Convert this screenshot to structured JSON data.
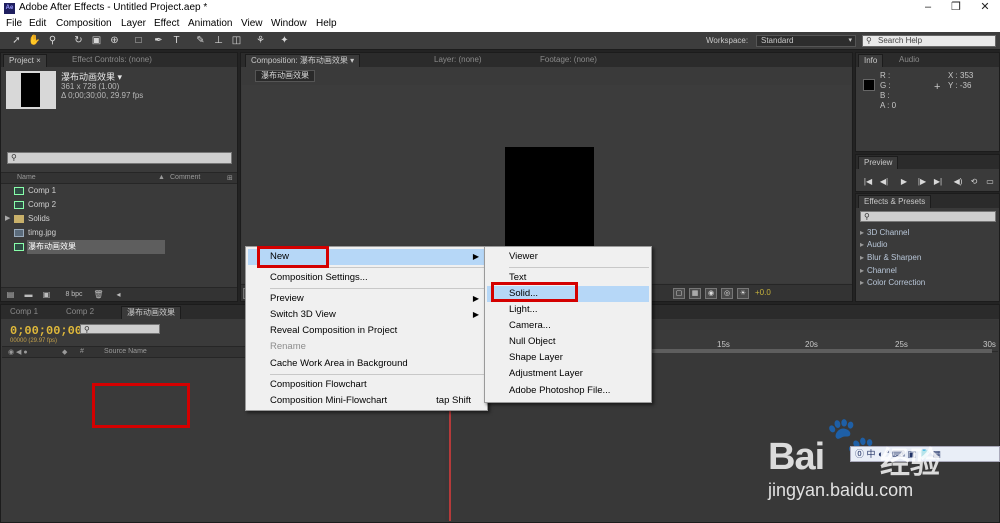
{
  "window": {
    "app_icon": "Ae",
    "title": "Adobe After Effects - Untitled Project.aep *",
    "minimize": "–",
    "maximize": "❐",
    "close": "✕"
  },
  "menubar": [
    "File",
    "Edit",
    "Composition",
    "Layer",
    "Effect",
    "Animation",
    "View",
    "Window",
    "Help"
  ],
  "toolbar": {
    "tools": [
      "selection-tool-icon",
      "hand-tool-icon",
      "zoom-tool-icon",
      "rotate-tool-icon",
      "camera-tool-icon",
      "pan-behind-tool-icon",
      "rectangle-tool-icon",
      "pen-tool-icon",
      "type-tool-icon",
      "brush-tool-icon",
      "clone-stamp-tool-icon",
      "eraser-tool-icon",
      "roto-brush-tool-icon",
      "puppet-pin-tool-icon"
    ],
    "workspace_label": "Workspace:",
    "workspace_value": "Standard",
    "help_search_placeholder": "Search Help"
  },
  "project_panel": {
    "tab_project": "Project",
    "tab_project_menu": "×",
    "tab_effect_controls": "Effect Controls: (none)",
    "comp_name": "瀑布动画效果 ▾",
    "comp_size": "361 x 728 (1.00)",
    "comp_duration": "Δ 0;00;30;00, 29.97 fps",
    "search_icon": "⚲",
    "col_name": "Name",
    "col_comment": "Comment",
    "items": [
      {
        "label": "Comp 1",
        "type": "comp"
      },
      {
        "label": "Comp 2",
        "type": "comp"
      },
      {
        "label": "Solids",
        "type": "folder"
      },
      {
        "label": "timg.jpg",
        "type": "image"
      },
      {
        "label": "瀑布动画效果",
        "type": "comp",
        "selected": true
      }
    ],
    "bpc": "8 bpc"
  },
  "comp_viewer": {
    "tab_composition": "Composition: 瀑布动画效果",
    "tab_layer": "Layer: (none)",
    "tab_footage": "Footage: (none)",
    "comp_chip": "瀑布动画效果",
    "exposure": "+0.0"
  },
  "info_panel": {
    "tab_info": "Info",
    "tab_audio": "Audio",
    "r": "R :",
    "g": "G :",
    "b": "B :",
    "a": "A : 0",
    "x": "X : 353",
    "y": "Y : -36",
    "plus": "+"
  },
  "preview_panel": {
    "tab": "Preview",
    "controls": [
      "|◀",
      "◀|",
      "▶",
      "|▶",
      "▶|",
      "◀)",
      "⟲",
      "▭"
    ]
  },
  "effects_panel": {
    "tab": "Effects & Presets",
    "items": [
      "3D Channel",
      "Audio",
      "Blur & Sharpen",
      "Channel",
      "Color Correction"
    ]
  },
  "timeline": {
    "tabs": [
      "Comp 1",
      "Comp 2",
      "瀑布动画效果"
    ],
    "timecode": "0;00;00;00",
    "fps": "00000 (29.97 fps)",
    "col_source_name": "Source Name",
    "ruler_ticks": [
      "15s",
      "20s",
      "25s",
      "30s"
    ]
  },
  "context_menu": {
    "items": [
      {
        "label": "New",
        "submenu": true,
        "highlighted": true
      },
      {
        "label": "Composition Settings..."
      },
      {
        "label": "Preview",
        "submenu": true
      },
      {
        "label": "Switch 3D View",
        "submenu": true
      },
      {
        "label": "Reveal Composition in Project"
      },
      {
        "label": "Rename",
        "disabled": true
      },
      {
        "label": "Cache Work Area in Background"
      },
      {
        "label": "Composition Flowchart"
      },
      {
        "label": "Composition Mini-Flowchart",
        "shortcut": "tap Shift"
      }
    ]
  },
  "new_submenu": {
    "items": [
      {
        "label": "Viewer"
      },
      {
        "label": "Text"
      },
      {
        "label": "Solid...",
        "highlighted": true
      },
      {
        "label": "Light..."
      },
      {
        "label": "Camera..."
      },
      {
        "label": "Null Object"
      },
      {
        "label": "Shape Layer"
      },
      {
        "label": "Adjustment Layer"
      },
      {
        "label": "Adobe Photoshop File..."
      }
    ]
  },
  "watermark": {
    "logo": "Bai",
    "logo_cn": "经验",
    "url": "jingyan.baidu.com"
  },
  "colors": {
    "highlight": "#b6d7f7",
    "annotation_red": "#d40000",
    "timecode": "#e0b93a"
  }
}
